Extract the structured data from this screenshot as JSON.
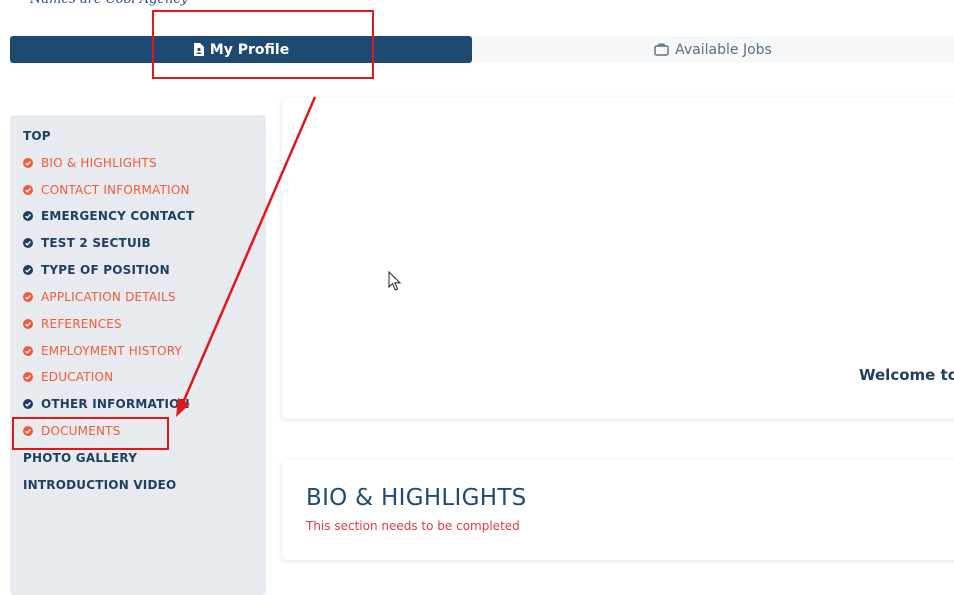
{
  "header": {
    "logo_text": "Names are Cool Agency"
  },
  "tabs": [
    {
      "label": "My Profile",
      "icon": "profile-doc-icon",
      "active": true
    },
    {
      "label": "Available Jobs",
      "icon": "briefcase-icon",
      "active": false
    }
  ],
  "sidebar": {
    "items": [
      {
        "label": "TOP",
        "status": "none"
      },
      {
        "label": "BIO & HIGHLIGHTS",
        "status": "incomplete"
      },
      {
        "label": "CONTACT INFORMATION",
        "status": "incomplete"
      },
      {
        "label": "EMERGENCY CONTACT",
        "status": "complete"
      },
      {
        "label": "TEST 2 SECTUIB",
        "status": "complete"
      },
      {
        "label": "TYPE OF POSITION",
        "status": "complete"
      },
      {
        "label": "APPLICATION DETAILS",
        "status": "incomplete"
      },
      {
        "label": "REFERENCES",
        "status": "incomplete"
      },
      {
        "label": "EMPLOYMENT HISTORY",
        "status": "incomplete"
      },
      {
        "label": "EDUCATION",
        "status": "incomplete"
      },
      {
        "label": "OTHER INFORMATION",
        "status": "complete"
      },
      {
        "label": "DOCUMENTS",
        "status": "incomplete"
      },
      {
        "label": "PHOTO GALLERY",
        "status": "none"
      },
      {
        "label": "INTRODUCTION VIDEO",
        "status": "none"
      }
    ]
  },
  "main": {
    "welcome_text": "Welcome to",
    "bio_section": {
      "title": "BIO & HIGHLIGHTS",
      "warning": "This section needs to be completed"
    }
  },
  "colors": {
    "brand_navy": "#1e4a72",
    "incomplete_orange": "#f15a3a",
    "warning_red": "#e5393f",
    "annotation_red": "#e01818"
  }
}
